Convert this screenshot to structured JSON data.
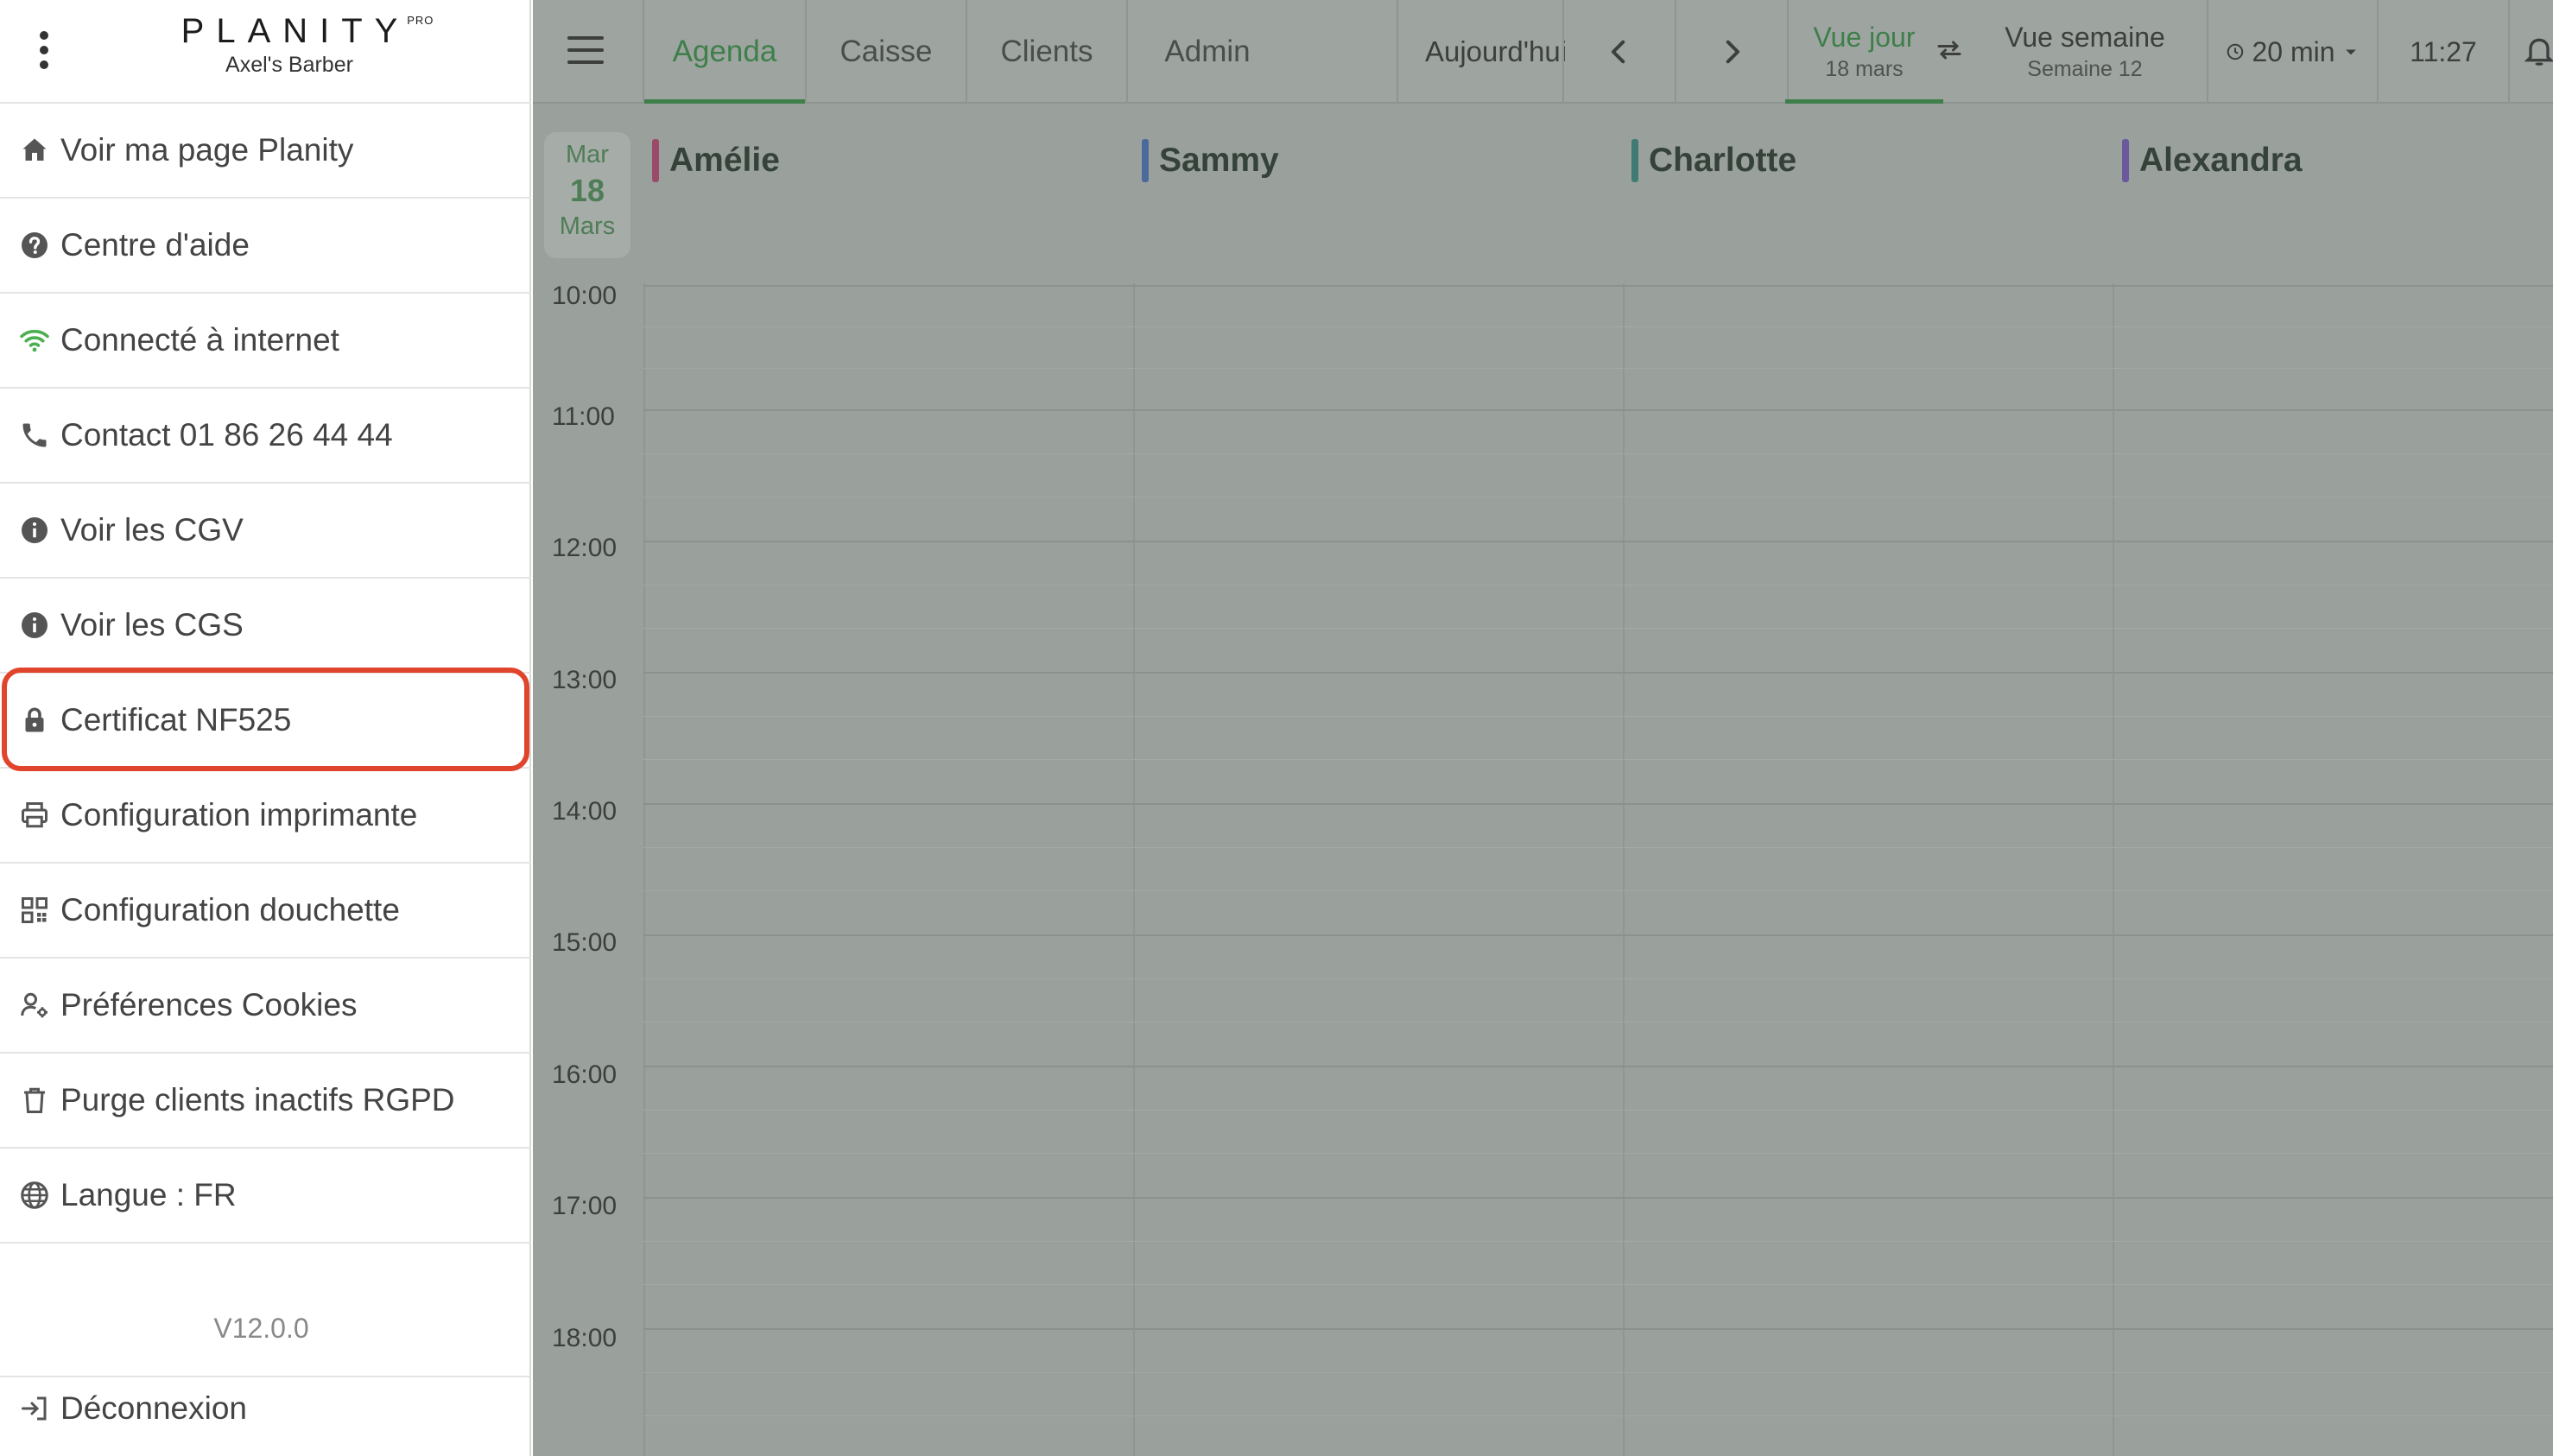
{
  "sidebar": {
    "brand": {
      "name": "PLANITY",
      "badge": "PRO",
      "salon": "Axel's Barber"
    },
    "items": [
      {
        "label": "Voir ma page Planity",
        "icon": "home-icon"
      },
      {
        "label": "Centre d'aide",
        "icon": "help-icon"
      },
      {
        "label": "Connecté à internet",
        "icon": "wifi-icon"
      },
      {
        "label": "Contact 01 86 26 44 44",
        "icon": "phone-icon"
      },
      {
        "label": "Voir les CGV",
        "icon": "info-icon"
      },
      {
        "label": "Voir les CGS",
        "icon": "info-icon"
      },
      {
        "label": "Certificat NF525",
        "icon": "lock-icon"
      },
      {
        "label": "Configuration imprimante",
        "icon": "printer-icon"
      },
      {
        "label": "Configuration douchette",
        "icon": "qr-code-icon"
      },
      {
        "label": "Préférences Cookies",
        "icon": "user-settings-icon"
      },
      {
        "label": "Purge clients inactifs RGPD",
        "icon": "trash-icon"
      },
      {
        "label": "Langue : FR",
        "icon": "globe-icon"
      }
    ],
    "highlighted_item": "Certificat NF525",
    "version": "V12.0.0",
    "logout_label": "Déconnexion"
  },
  "topbar": {
    "tabs": [
      {
        "label": "Agenda",
        "active": true
      },
      {
        "label": "Caisse",
        "active": false
      },
      {
        "label": "Clients",
        "active": false
      },
      {
        "label": "Admin",
        "active": false
      }
    ],
    "today_label": "Aujourd'hui",
    "day_view": {
      "title": "Vue jour",
      "subtitle": "18 mars"
    },
    "week_view": {
      "title": "Vue semaine",
      "subtitle": "Semaine 12"
    },
    "slot_duration": "20 min",
    "current_time": "11:27"
  },
  "calendar": {
    "date": {
      "weekday": "Mar",
      "day": "18",
      "month": "Mars"
    },
    "staff": [
      {
        "name": "Amélie",
        "color": "#9b4a6a"
      },
      {
        "name": "Sammy",
        "color": "#4a6a9b"
      },
      {
        "name": "Charlotte",
        "color": "#3f7a74"
      },
      {
        "name": "Alexandra",
        "color": "#6a5a9b"
      }
    ],
    "hours": [
      "10:00",
      "11:00",
      "12:00",
      "13:00",
      "14:00",
      "15:00",
      "16:00",
      "17:00",
      "18:00"
    ]
  },
  "colors": {
    "accent_green": "#3e7f4a",
    "highlight_red": "#e0442c",
    "wifi_green": "#4caf50",
    "overlay_gray": "#9aa09c"
  }
}
